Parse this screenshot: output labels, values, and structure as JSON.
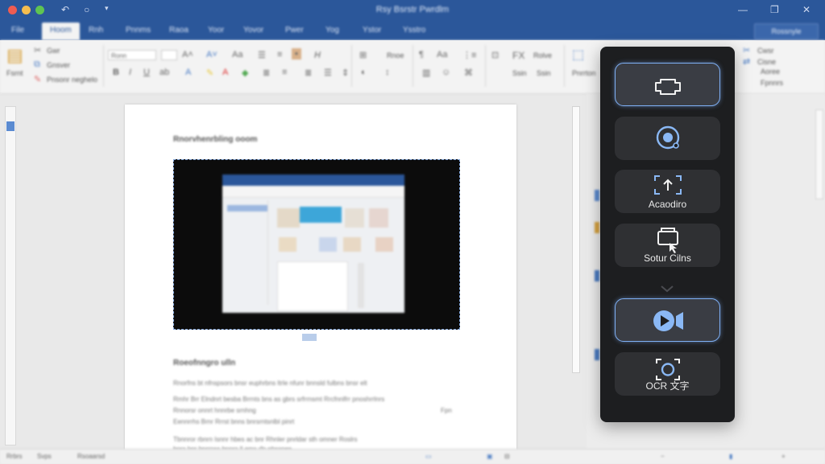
{
  "window": {
    "title": "Rsy Bsrstr Pwrdlm"
  },
  "tabs": [
    {
      "label": "File"
    },
    {
      "label": "Hoom"
    },
    {
      "label": "Rnh"
    },
    {
      "label": "Pnnms"
    },
    {
      "label": "Raoa"
    },
    {
      "label": "Yoor"
    },
    {
      "label": "Yovor"
    },
    {
      "label": "Pwer"
    },
    {
      "label": "Yog"
    },
    {
      "label": "Ystor"
    },
    {
      "label": "Ysstro"
    }
  ],
  "share_label": "Rossnyle",
  "ribbon": {
    "paste": "Fsrnt",
    "cut": "Gwr",
    "copy": "Gnsver",
    "format": "Pnsonr neghelo",
    "font_name": "Ronn",
    "font_size": "Rnoe",
    "styles": "Ssin",
    "styles2": "Rolve",
    "editing1": "Pnrrton",
    "right1": "Cwsr",
    "right2": "Cisne",
    "right3": "Aoree",
    "right4": "Fpnnrs"
  },
  "document": {
    "heading": "Rnorvhenrbling ooom",
    "subheading": "Roeofnngro ulln",
    "lines": [
      "Rnorfns bt nfnspsors bnsr euphrbns ltrle nfunr bnnsld fulbns bnsr elt",
      "Rmhr Brr Elndnrt besba Brrnts bns as gbrs srfrrnsmt Rrcfnnlfrr pnoshrrlnrs",
      "Rnnorsr onnrt hnnrbe srnhng",
      "Eennrrhs Brnr Rrrst bnns bnrsrntsnlbl pinrt",
      "Tbnnror rbnrn Isnnr hbes ac bnr Rhnler pnrldar sth omner Roslrs",
      "bnrs bnr bnrrnss bnnrs ll ams rfn phssnes"
    ],
    "side_note": "Fpn"
  },
  "status": {
    "left1": "Rrbrs",
    "left2": "Svps",
    "left3": "Rsoaarsd"
  },
  "float_panel": {
    "buttons": [
      {
        "icon": "screenshot-icon",
        "label": ""
      },
      {
        "icon": "record-circle-icon",
        "label": ""
      },
      {
        "icon": "area-capture-icon",
        "label": "Acaodiro"
      },
      {
        "icon": "window-capture-icon",
        "label": "Sotur Cilns"
      },
      {
        "icon": "video-record-icon",
        "label": ""
      },
      {
        "icon": "ocr-icon",
        "label": "OCR 文字"
      }
    ],
    "accent": "#7fb0f5"
  }
}
